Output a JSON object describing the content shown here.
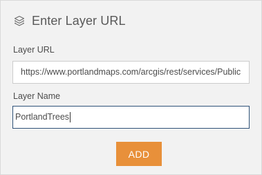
{
  "dialog": {
    "title": "Enter Layer URL",
    "title_icon": "layers-icon"
  },
  "fields": {
    "url": {
      "label": "Layer URL",
      "value": "https://www.portlandmaps.com/arcgis/rest/services/Public"
    },
    "name": {
      "label": "Layer Name",
      "value": "PortlandTrees"
    }
  },
  "actions": {
    "add_label": "ADD"
  },
  "colors": {
    "accent_button": "#e8903a",
    "focus_border": "#2f5278",
    "panel_background": "#f2f2f2"
  }
}
